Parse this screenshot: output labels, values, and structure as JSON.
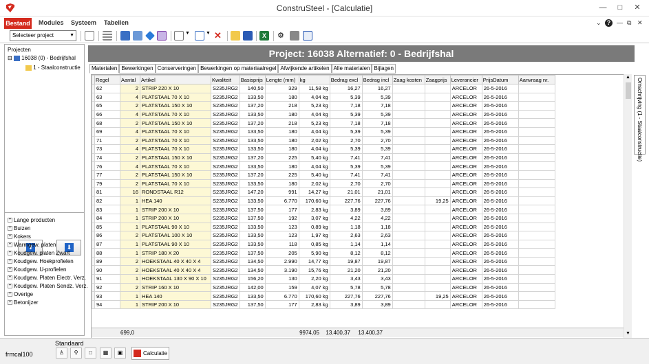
{
  "window": {
    "title": "ConstruSteel - [Calculatie]"
  },
  "menu": {
    "items": [
      "Bestand",
      "Modules",
      "Systeem",
      "Tabellen"
    ]
  },
  "toolbar": {
    "project_select": "Selecteer project"
  },
  "left": {
    "projects_label": "Projecten",
    "tree": [
      "16038 (0) - Bedrijfshal",
      "1 - Staalconstructie"
    ],
    "categories": [
      "Lange producten",
      "Buizen",
      "Kokers",
      "Warmgew. platen",
      "Koudgew. platen Zwart",
      "Koudgew. Hoekprofielen",
      "Koudgew. U-profielen",
      "Koudgew. Platen Electr. Verz.",
      "Koudgew. Platen Sendz. Verz.",
      "Overige",
      "Betonijzer"
    ]
  },
  "main": {
    "banner": "Project: 16038 Alternatief: 0 - Bedrijfshal",
    "tabs": [
      "Materialen",
      "Bewerkingen",
      "Conserveringen",
      "Bewerkingen op materiaalregel",
      "Afwijkende artikelen",
      "Alle materialen",
      "Bijlagen"
    ],
    "side_tab": "Omschrijving (1 - Staalconstructie)",
    "columns": [
      "Regel",
      "Aantal",
      "Artikel",
      "Kwaliteit",
      "Basisprijs",
      "Lengte (mm)",
      "kg",
      "Bedrag excl",
      "Bedrag incl",
      "Zaag kosten",
      "Zaagprijs",
      "Leverancier",
      "PrijsDatum",
      "Aanvraag nr."
    ],
    "rows": [
      [
        "62",
        "2",
        "STRIP 220 X 10",
        "S235JRG2",
        "140,50",
        "329",
        "11,58 kg",
        "16,27",
        "16,27",
        "",
        "",
        "ARCELOR",
        "26-5-2016",
        ""
      ],
      [
        "63",
        "4",
        "PLATSTAAL 70 X 10",
        "S235JRG2",
        "133,50",
        "180",
        "4,04 kg",
        "5,39",
        "5,39",
        "",
        "",
        "ARCELOR",
        "26-5-2016",
        ""
      ],
      [
        "65",
        "2",
        "PLATSTAAL 150 X 10",
        "S235JRG2",
        "137,20",
        "218",
        "5,23 kg",
        "7,18",
        "7,18",
        "",
        "",
        "ARCELOR",
        "26-5-2016",
        ""
      ],
      [
        "66",
        "4",
        "PLATSTAAL 70 X 10",
        "S235JRG2",
        "133,50",
        "180",
        "4,04 kg",
        "5,39",
        "5,39",
        "",
        "",
        "ARCELOR",
        "26-5-2016",
        ""
      ],
      [
        "68",
        "2",
        "PLATSTAAL 150 X 10",
        "S235JRG2",
        "137,20",
        "218",
        "5,23 kg",
        "7,18",
        "7,18",
        "",
        "",
        "ARCELOR",
        "26-5-2016",
        ""
      ],
      [
        "69",
        "4",
        "PLATSTAAL 70 X 10",
        "S235JRG2",
        "133,50",
        "180",
        "4,04 kg",
        "5,39",
        "5,39",
        "",
        "",
        "ARCELOR",
        "26-5-2016",
        ""
      ],
      [
        "71",
        "2",
        "PLATSTAAL 70 X 10",
        "S235JRG2",
        "133,50",
        "180",
        "2,02 kg",
        "2,70",
        "2,70",
        "",
        "",
        "ARCELOR",
        "26-5-2016",
        ""
      ],
      [
        "73",
        "4",
        "PLATSTAAL 70 X 10",
        "S235JRG2",
        "133,50",
        "180",
        "4,04 kg",
        "5,39",
        "5,39",
        "",
        "",
        "ARCELOR",
        "26-5-2016",
        ""
      ],
      [
        "74",
        "2",
        "PLATSTAAL 150 X 10",
        "S235JRG2",
        "137,20",
        "225",
        "5,40 kg",
        "7,41",
        "7,41",
        "",
        "",
        "ARCELOR",
        "26-5-2016",
        ""
      ],
      [
        "76",
        "4",
        "PLATSTAAL 70 X 10",
        "S235JRG2",
        "133,50",
        "180",
        "4,04 kg",
        "5,39",
        "5,39",
        "",
        "",
        "ARCELOR",
        "26-5-2016",
        ""
      ],
      [
        "77",
        "2",
        "PLATSTAAL 150 X 10",
        "S235JRG2",
        "137,20",
        "225",
        "5,40 kg",
        "7,41",
        "7,41",
        "",
        "",
        "ARCELOR",
        "26-5-2016",
        ""
      ],
      [
        "79",
        "2",
        "PLATSTAAL 70 X 10",
        "S235JRG2",
        "133,50",
        "180",
        "2,02 kg",
        "2,70",
        "2,70",
        "",
        "",
        "ARCELOR",
        "26-5-2016",
        ""
      ],
      [
        "81",
        "16",
        "RONDSTAAL R12",
        "S235JRG2",
        "147,20",
        "991",
        "14,27 kg",
        "21,01",
        "21,01",
        "",
        "",
        "ARCELOR",
        "26-5-2016",
        ""
      ],
      [
        "82",
        "1",
        "HEA 140",
        "S235JRG2",
        "133,50",
        "6.770",
        "170,60 kg",
        "227,76",
        "227,76",
        "",
        "19,25",
        "ARCELOR",
        "26-5-2016",
        ""
      ],
      [
        "83",
        "1",
        "STRIP 200 X 10",
        "S235JRG2",
        "137,50",
        "177",
        "2,83 kg",
        "3,89",
        "3,89",
        "",
        "",
        "ARCELOR",
        "26-5-2016",
        ""
      ],
      [
        "84",
        "1",
        "STRIP 200 X 10",
        "S235JRG2",
        "137,50",
        "192",
        "3,07 kg",
        "4,22",
        "4,22",
        "",
        "",
        "ARCELOR",
        "26-5-2016",
        ""
      ],
      [
        "85",
        "1",
        "PLATSTAAL 90 X 10",
        "S235JRG2",
        "133,50",
        "123",
        "0,89 kg",
        "1,18",
        "1,18",
        "",
        "",
        "ARCELOR",
        "26-5-2016",
        ""
      ],
      [
        "86",
        "2",
        "PLATSTAAL 100 X 10",
        "S235JRG2",
        "133,50",
        "123",
        "1,97 kg",
        "2,63",
        "2,63",
        "",
        "",
        "ARCELOR",
        "26-5-2016",
        ""
      ],
      [
        "87",
        "1",
        "PLATSTAAL 90 X 10",
        "S235JRG2",
        "133,50",
        "118",
        "0,85 kg",
        "1,14",
        "1,14",
        "",
        "",
        "ARCELOR",
        "26-5-2016",
        ""
      ],
      [
        "88",
        "1",
        "STRIP 180 X 20",
        "S235JRG2",
        "137,50",
        "205",
        "5,90 kg",
        "8,12",
        "8,12",
        "",
        "",
        "ARCELOR",
        "26-5-2016",
        ""
      ],
      [
        "89",
        "2",
        "HOEKSTAAL 40 X 40 X 4",
        "S235JRG2",
        "134,50",
        "2.990",
        "14,77 kg",
        "19,87",
        "19,87",
        "",
        "",
        "ARCELOR",
        "26-5-2016",
        ""
      ],
      [
        "90",
        "2",
        "HOEKSTAAL 40 X 40 X 4",
        "S235JRG2",
        "134,50",
        "3.190",
        "15,76 kg",
        "21,20",
        "21,20",
        "",
        "",
        "ARCELOR",
        "26-5-2016",
        ""
      ],
      [
        "91",
        "1",
        "HOEKSTAAL 130 X 90 X 10",
        "S235JRG2",
        "156,20",
        "130",
        "2,20 kg",
        "3,43",
        "3,43",
        "",
        "",
        "ARCELOR",
        "26-5-2016",
        ""
      ],
      [
        "92",
        "2",
        "STRIP 160 X 10",
        "S235JRG2",
        "142,00",
        "159",
        "4,07 kg",
        "5,78",
        "5,78",
        "",
        "",
        "ARCELOR",
        "26-5-2016",
        ""
      ],
      [
        "93",
        "1",
        "HEA 140",
        "S235JRG2",
        "133,50",
        "6.770",
        "170,60 kg",
        "227,76",
        "227,76",
        "",
        "19,25",
        "ARCELOR",
        "26-5-2016",
        ""
      ],
      [
        "94",
        "1",
        "STRIP 200 X 10",
        "S235JRG2",
        "137,50",
        "177",
        "2,83 kg",
        "3,89",
        "3,89",
        "",
        "",
        "ARCELOR",
        "26-5-2016",
        ""
      ]
    ],
    "totals": {
      "aantal": "699,0",
      "kg": "9974,05",
      "excl": "13.400,37",
      "incl": "13.400,37"
    }
  },
  "status": {
    "standaard": "Standaard",
    "form": "frmcal100",
    "calc_tab": "Calculatie"
  },
  "colors": {
    "accent": "#d42a1e",
    "banner": "#7a7a7a",
    "editable": "#fdf8d5"
  }
}
